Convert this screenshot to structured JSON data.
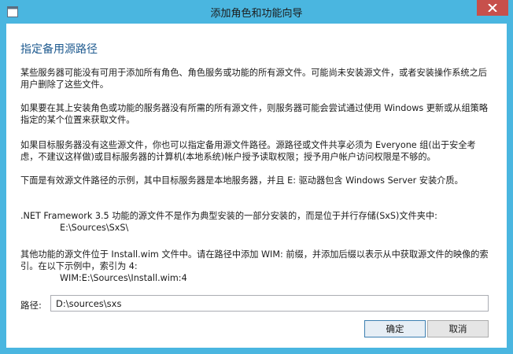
{
  "window": {
    "title": "添加角色和功能向导"
  },
  "page": {
    "heading": "指定备用源路径",
    "paragraphs": {
      "p1": "某些服务器可能没有可用于添加所有角色、角色服务或功能的所有源文件。可能尚未安装源文件，或者安装操作系统之后用户删除了这些文件。",
      "p2": "如果要在其上安装角色或功能的服务器没有所需的所有源文件，则服务器可能会尝试通过使用 Windows 更新或从组策略指定的某个位置来获取文件。",
      "p3": "如果目标服务器没有这些源文件，你也可以指定备用源文件路径。源路径或文件共享必须为 Everyone 组(出于安全考虑，不建议这样做)或目标服务器的计算机(本地系统)帐户授予读取权限；授予用户帐户访问权限是不够的。",
      "p4": "下面是有效源文件路径的示例，其中目标服务器是本地服务器，并且 E: 驱动器包含 Windows Server 安装介质。",
      "p5": ".NET Framework 3.5 功能的源文件不是作为典型安装的一部分安装的，而是位于并行存储(SxS)文件夹中:",
      "p5_example": "E:\\Sources\\SxS\\",
      "p6": "其他功能的源文件位于 Install.wim 文件中。请在路径中添加 WIM: 前缀，并添加后缀以表示从中获取源文件的映像的索引。在以下示例中，索引为 4:",
      "p6_example": "WIM:E:\\Sources\\Install.wim:4"
    },
    "path": {
      "label": "路径:",
      "value": "D:\\sources\\sxs"
    },
    "buttons": {
      "ok": "确定",
      "cancel": "取消"
    }
  },
  "icons": {
    "window_icon": "system-menu-icon",
    "close": "close-icon"
  },
  "colors": {
    "frame": "#4ab6e0",
    "heading": "#1e5a8f",
    "close_button": "#c7504b"
  }
}
